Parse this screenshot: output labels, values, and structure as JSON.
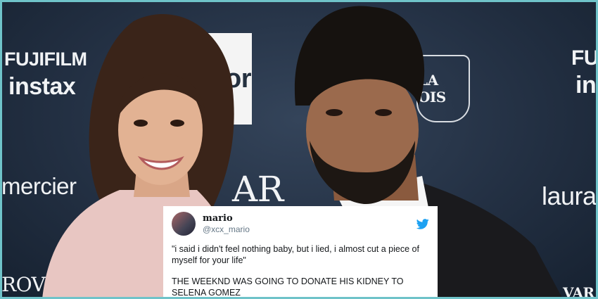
{
  "backdrop": {
    "logos": {
      "fujifilm_left_top": "FUJIFILM",
      "fujifilm_left_bottom": "instax",
      "dior": "Dior",
      "mercier": "mercier",
      "bazaar": "AR",
      "stella": "LA OIS",
      "fujifilm_right_top": "FUJ",
      "fujifilm_right_bottom": "in",
      "laura": "laura",
      "grove": "ROV",
      "var": "VAR"
    }
  },
  "tweet": {
    "display_name": "mario",
    "handle": "@xcx_mario",
    "icon": "twitter-bird-icon",
    "line1": "\"i said i didn't feel nothing baby, but i lied, i almost cut a piece of myself for your life\"",
    "line2": "THE WEEKND WAS GOING TO DONATE HIS KIDNEY TO SELENA GOMEZ"
  },
  "colors": {
    "backdrop": "#233043",
    "frame_border": "#6fc3c9",
    "twitter_blue": "#1da1f2"
  }
}
